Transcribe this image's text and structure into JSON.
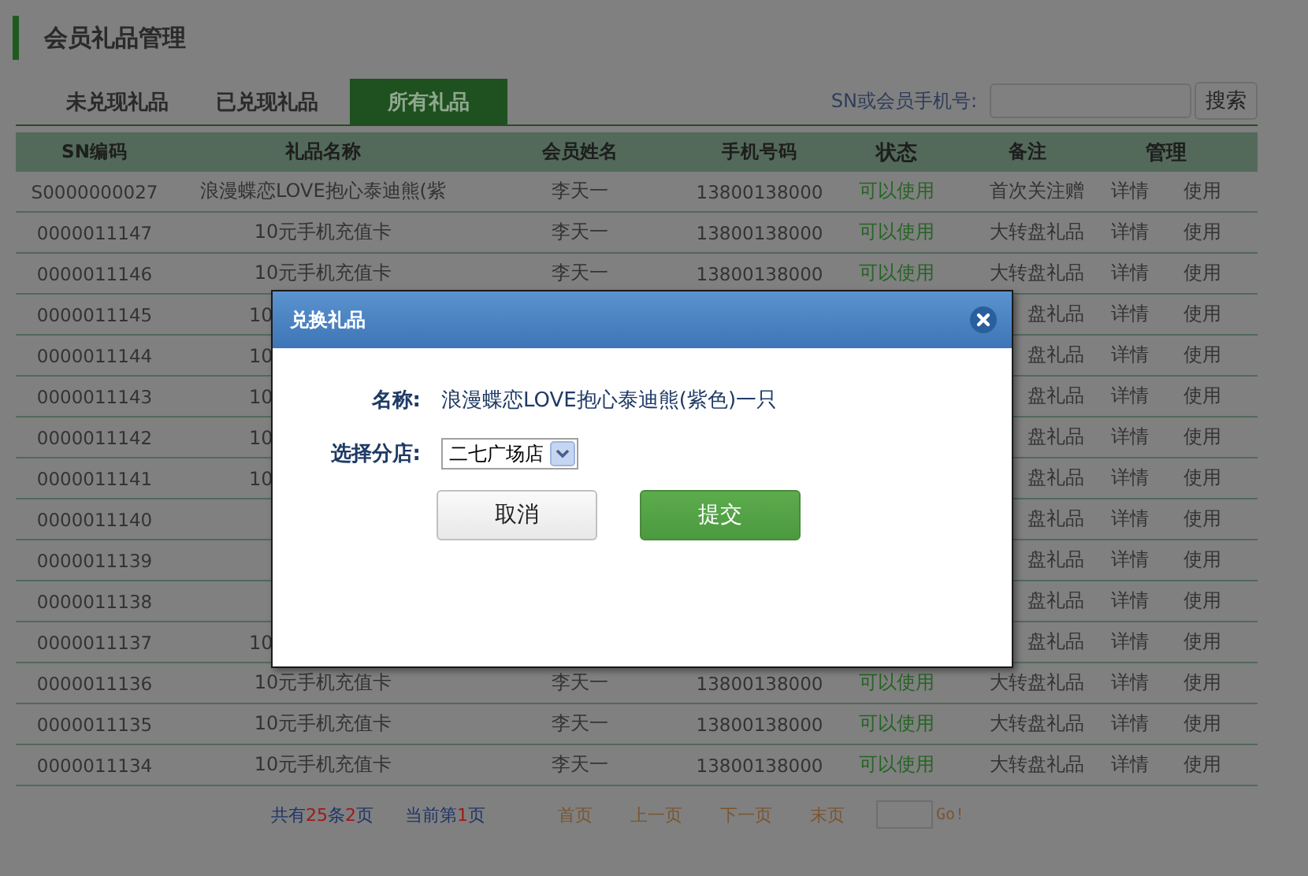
{
  "page_title": "会员礼品管理",
  "tabs": [
    {
      "label": "未兑现礼品",
      "selected": false
    },
    {
      "label": "已兑现礼品",
      "selected": false
    },
    {
      "label": "所有礼品",
      "selected": true
    }
  ],
  "search": {
    "label": "SN或会员手机号:",
    "button": "搜索"
  },
  "table": {
    "columns": [
      "SN编码",
      "礼品名称",
      "会员姓名",
      "手机号码",
      "状态",
      "备注",
      "管理"
    ],
    "rows": [
      {
        "kind": "full",
        "sn": "S0000000027",
        "name": "浪漫蝶恋LOVE抱心泰迪熊(紫",
        "member": "李天一",
        "phone": "13800138000",
        "status": "可以使用",
        "remark": "首次关注赠",
        "detail": "详情",
        "use": "使用"
      },
      {
        "kind": "full",
        "sn": "0000011147",
        "name": "10元手机充值卡",
        "member": "李天一",
        "phone": "13800138000",
        "status": "可以使用",
        "remark": "大转盘礼品",
        "detail": "详情",
        "use": "使用"
      },
      {
        "kind": "full",
        "sn": "0000011146",
        "name": "10元手机充值卡",
        "member": "李天一",
        "phone": "13800138000",
        "status": "可以使用",
        "remark": "大转盘礼品",
        "detail": "详情",
        "use": "使用"
      },
      {
        "kind": "partial",
        "sn": "0000011145",
        "name": "10",
        "remark": "盘礼品",
        "detail": "详情",
        "use": "使用"
      },
      {
        "kind": "partial",
        "sn": "0000011144",
        "name": "10",
        "remark": "盘礼品",
        "detail": "详情",
        "use": "使用"
      },
      {
        "kind": "partial",
        "sn": "0000011143",
        "name": "10",
        "remark": "盘礼品",
        "detail": "详情",
        "use": "使用"
      },
      {
        "kind": "partial",
        "sn": "0000011142",
        "name": "10",
        "remark": "盘礼品",
        "detail": "详情",
        "use": "使用"
      },
      {
        "kind": "partial",
        "sn": "0000011141",
        "name": "10",
        "remark": "盘礼品",
        "detail": "详情",
        "use": "使用"
      },
      {
        "kind": "partial",
        "sn": "0000011140",
        "remark": "盘礼品",
        "detail": "详情",
        "use": "使用"
      },
      {
        "kind": "partial",
        "sn": "0000011139",
        "remark": "盘礼品",
        "detail": "详情",
        "use": "使用"
      },
      {
        "kind": "partial",
        "sn": "0000011138",
        "remark": "盘礼品",
        "detail": "详情",
        "use": "使用"
      },
      {
        "kind": "partial",
        "sn": "0000011137",
        "name": "10",
        "remark": "盘礼品",
        "detail": "详情",
        "use": "使用"
      },
      {
        "kind": "full",
        "sn": "0000011136",
        "name": "10元手机充值卡",
        "member": "李天一",
        "phone": "13800138000",
        "status": "可以使用",
        "remark": "大转盘礼品",
        "detail": "详情",
        "use": "使用"
      },
      {
        "kind": "full",
        "sn": "0000011135",
        "name": "10元手机充值卡",
        "member": "李天一",
        "phone": "13800138000",
        "status": "可以使用",
        "remark": "大转盘礼品",
        "detail": "详情",
        "use": "使用"
      },
      {
        "kind": "full",
        "sn": "0000011134",
        "name": "10元手机充值卡",
        "member": "李天一",
        "phone": "13800138000",
        "status": "可以使用",
        "remark": "大转盘礼品",
        "detail": "详情",
        "use": "使用"
      }
    ]
  },
  "pagination": {
    "summary": [
      {
        "text": "共有",
        "highlight": false
      },
      {
        "text": "25",
        "highlight": true
      },
      {
        "text": "条",
        "highlight": false
      },
      {
        "text": "2",
        "highlight": true
      },
      {
        "text": "页",
        "highlight": false
      }
    ],
    "current": [
      {
        "text": "当前第",
        "highlight": false
      },
      {
        "text": "1",
        "highlight": true
      },
      {
        "text": "页",
        "highlight": false
      }
    ],
    "links": [
      "首页",
      "上一页",
      "下一页",
      "末页"
    ],
    "go": "Go!"
  },
  "modal": {
    "title": "兑换礼品",
    "name_label": "名称:",
    "name_value": "浪漫蝶恋LOVE抱心泰迪熊(紫色)一只",
    "store_label": "选择分店:",
    "store_value": "二七广场店",
    "cancel": "取消",
    "submit": "提交"
  }
}
